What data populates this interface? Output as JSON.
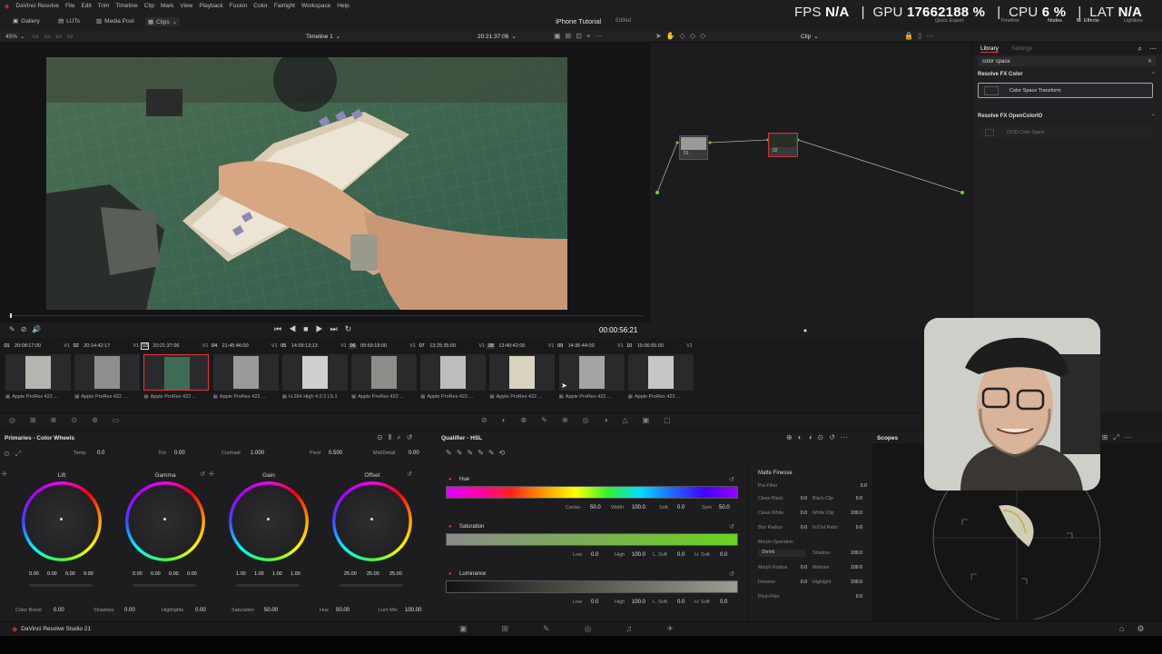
{
  "app": {
    "menu": [
      "DaVinci Resolve",
      "File",
      "Edit",
      "Trim",
      "Timeline",
      "Clip",
      "Mark",
      "View",
      "Playback",
      "Fusion",
      "Color",
      "Fairlight",
      "Workspace",
      "Help"
    ],
    "project_title": "iPhone Tutorial",
    "project_status": "Edited",
    "product": "DaVinci Resolve Studio 21"
  },
  "hud": {
    "fps_label": "FPS",
    "fps_value": "N/A",
    "gpu_label": "GPU",
    "gpu_value": "17662188 %",
    "cpu_label": "CPU",
    "cpu_value": "6 %",
    "lat_label": "LAT",
    "lat_value": "N/A"
  },
  "toolbar": {
    "gallery": "Gallery",
    "luts": "LUTs",
    "media_pool": "Media Pool",
    "clips": "Clips",
    "quick_export": "Quick Export",
    "timeline": "Timeline",
    "nodes": "Nodes",
    "effects": "Effects",
    "lightbox": "Lightbox"
  },
  "viewer": {
    "zoom": "45%",
    "timeline_name": "Timeline 1",
    "timecode": "20:21:37:06",
    "playhead_time": "00:00:56:21",
    "progress": 0.01
  },
  "nodes": {
    "mode": "Clip",
    "node1": "01",
    "node2": "02"
  },
  "library": {
    "tab_library": "Library",
    "tab_settings": "Settings",
    "search_value": "color space",
    "group1": "Resolve FX Color",
    "item1": "Color Space Transform",
    "group2": "Resolve FX OpenColorIO",
    "item2": "OCIO Color Space"
  },
  "clips": [
    {
      "num": "01",
      "tc": "20:08:17:00",
      "track": "V1",
      "codec": "Apple ProRes 422 ..."
    },
    {
      "num": "02",
      "tc": "20:14:42:17",
      "track": "V1",
      "codec": "Apple ProRes 422 ..."
    },
    {
      "num": "03",
      "tc": "20:21:37:06",
      "track": "V1",
      "codec": "Apple ProRes 422 ..."
    },
    {
      "num": "04",
      "tc": "21:45:46:00",
      "track": "V1",
      "codec": "Apple ProRes 422 ..."
    },
    {
      "num": "05",
      "tc": "14:09:13;13",
      "track": "V1",
      "codec": "H.264 High 4:2:2 L5.1"
    },
    {
      "num": "06",
      "tc": "09:59:18:00",
      "track": "V1",
      "codec": "Apple ProRes 422 ..."
    },
    {
      "num": "07",
      "tc": "13:25:35:00",
      "track": "V1",
      "codec": "Apple ProRes 422 ..."
    },
    {
      "num": "08",
      "tc": "13:40:42:00",
      "track": "V1",
      "codec": "Apple ProRes 422 ..."
    },
    {
      "num": "09",
      "tc": "14:36:44:00",
      "track": "V1",
      "codec": "Apple ProRes 422 ..."
    },
    {
      "num": "10",
      "tc": "15:06:55:00",
      "track": "V1",
      "codec": "Apple ProRes 422 ..."
    }
  ],
  "primaries": {
    "title": "Primaries - Color Wheels",
    "temp_label": "Temp",
    "temp": "0.0",
    "tint_label": "Tint",
    "tint": "0.00",
    "contrast_label": "Contrast",
    "contrast": "1.000",
    "pivot_label": "Pivot",
    "pivot": "0.500",
    "middetail_label": "Mid/Detail",
    "middetail": "0.00",
    "wheels": [
      {
        "name": "Lift",
        "values": [
          "0.00",
          "0.00",
          "0.00",
          "0.00"
        ]
      },
      {
        "name": "Gamma",
        "values": [
          "0.00",
          "0.00",
          "0.00",
          "0.00"
        ]
      },
      {
        "name": "Gain",
        "values": [
          "1.00",
          "1.00",
          "1.00",
          "1.00"
        ]
      },
      {
        "name": "Offset",
        "values": [
          "25.00",
          "25.00",
          "25.00"
        ]
      }
    ],
    "colorboost_label": "Color Boost",
    "colorboost": "0.00",
    "shadows_label": "Shadows",
    "shadows": "0.00",
    "highlights_label": "Highlights",
    "highlights": "0.00",
    "saturation_label": "Saturation",
    "saturation": "50.00",
    "hue_label": "Hue",
    "hue": "50.00",
    "lummix_label": "Lum Mix",
    "lummix": "100.00"
  },
  "qualifier": {
    "title": "Qualifier - HSL",
    "hue": "Hue",
    "hue_center_label": "Center",
    "hue_center": "50.0",
    "hue_width_label": "Width",
    "hue_width": "100.0",
    "hue_soft_label": "Soft",
    "hue_soft": "0.0",
    "hue_sym_label": "Sym",
    "hue_sym": "50.0",
    "saturation": "Saturation",
    "sat_low_label": "Low",
    "sat_low": "0.0",
    "sat_high_label": "High",
    "sat_high": "100.0",
    "sat_lsoft_label": "L. Soft",
    "sat_lsoft": "0.0",
    "sat_hsoft_label": "H. Soft",
    "sat_hsoft": "0.0",
    "luminance": "Luminance",
    "lum_low_label": "Low",
    "lum_low": "0.0",
    "lum_high_label": "High",
    "lum_high": "100.0",
    "lum_lsoft_label": "L. Soft",
    "lum_lsoft": "0.0",
    "lum_hsoft_label": "H. Soft",
    "lum_hsoft": "0.0"
  },
  "matte_finesse": {
    "title": "Matte Finesse",
    "prefilter_label": "Pre-Filter",
    "prefilter": "0.0",
    "cleanblack_label": "Clean Black",
    "cleanblack": "0.0",
    "blackclip_label": "Black Clip",
    "blackclip": "0.0",
    "cleanwhite_label": "Clean White",
    "cleanwhite": "0.0",
    "whiteclip_label": "White Clip",
    "whiteclip": "100.0",
    "blurradius_label": "Blur Radius",
    "blurradius": "0.0",
    "inoutratio_label": "In/Out Ratio",
    "inoutratio": "0.0",
    "morph_label": "Morph Operation",
    "shrink": "Shrink",
    "shadow_label": "Shadow",
    "shadow": "100.0",
    "morphradius_label": "Morph Radius",
    "morphradius": "0.0",
    "midtone_label": "Midtone",
    "midtone": "100.0",
    "denoise_label": "Denoise",
    "denoise": "0.0",
    "highlight_label": "Highlight",
    "highlight": "100.0",
    "postfilter_label": "Post-Filter",
    "postfilter": "0.0"
  },
  "scopes": {
    "title": "Scopes"
  },
  "colors": {
    "accent": "#e53935",
    "hud_text": "#ffffff",
    "panel_bg": "#1d1d1f"
  }
}
